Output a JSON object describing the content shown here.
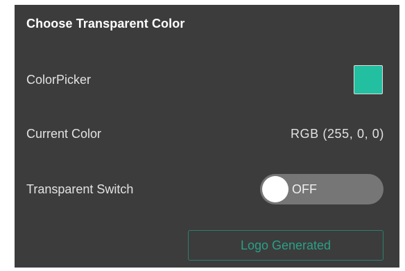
{
  "panel": {
    "title": "Choose Transparent Color"
  },
  "color_picker": {
    "label": "ColorPicker",
    "swatch_color": "#22bfa0"
  },
  "current_color": {
    "label": "Current Color",
    "value": "RGB (255, 0, 0)"
  },
  "transparent_switch": {
    "label": "Transparent Switch",
    "state_text": "OFF",
    "on": false
  },
  "logo_button": {
    "label": "Logo Generated",
    "accent_color": "#2aa088"
  }
}
